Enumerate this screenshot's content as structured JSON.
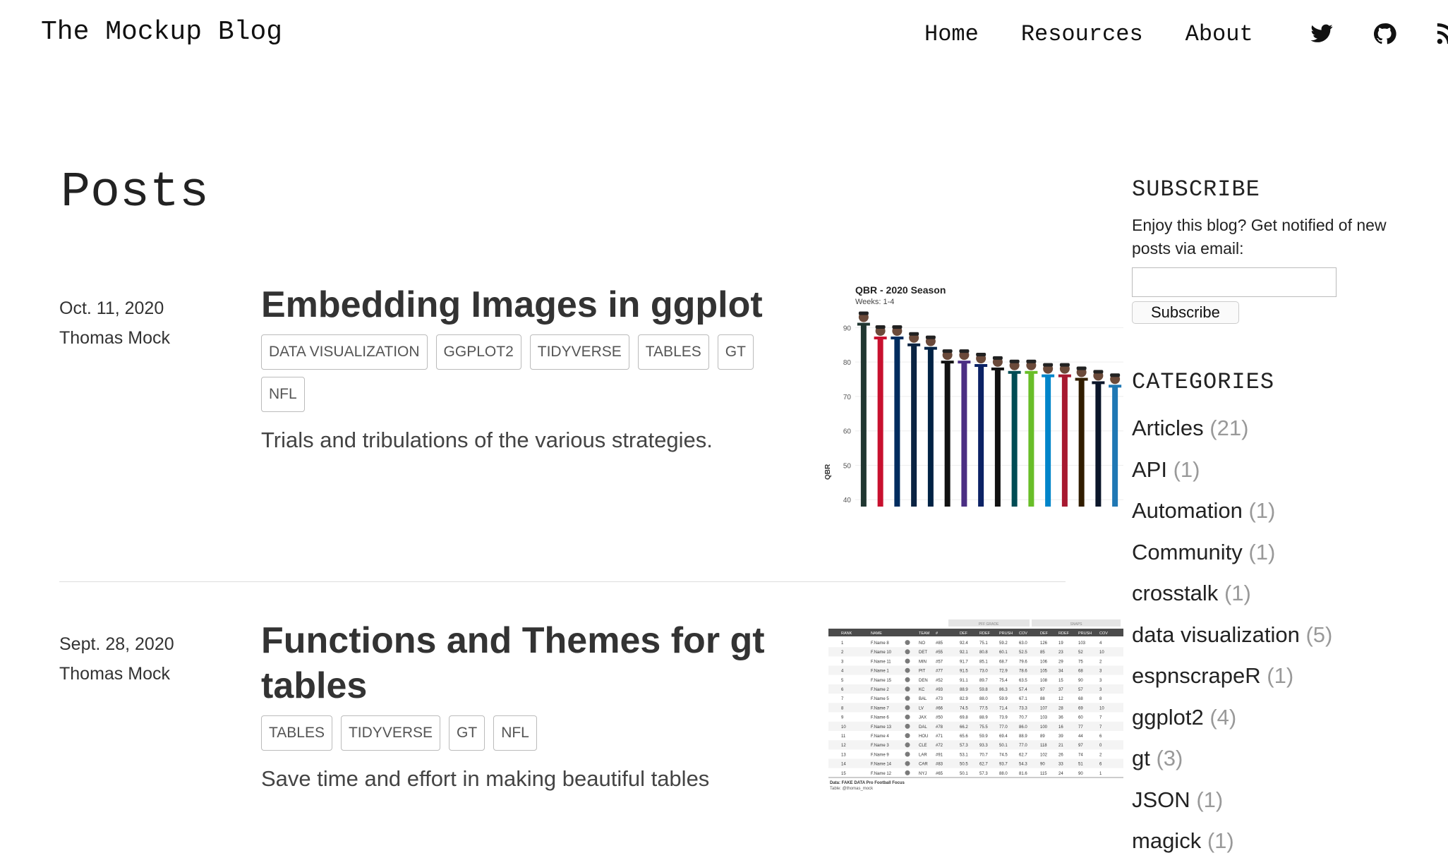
{
  "site": {
    "title": "The Mockup Blog"
  },
  "nav": {
    "links": [
      "Home",
      "Resources",
      "About"
    ],
    "icons": [
      "twitter-icon",
      "github-icon",
      "rss-icon"
    ]
  },
  "page": {
    "heading": "Posts"
  },
  "posts": [
    {
      "date": "Oct. 11, 2020",
      "author": "Thomas Mock",
      "title": "Embedding Images in ggplot",
      "tags": [
        "DATA VISUALIZATION",
        "GGPLOT2",
        "TIDYVERSE",
        "TABLES",
        "GT",
        "NFL"
      ],
      "description": "Trials and tribulations of the various strategies."
    },
    {
      "date": "Sept. 28, 2020",
      "author": "Thomas Mock",
      "title": "Functions and Themes for gt tables",
      "tags": [
        "TABLES",
        "TIDYVERSE",
        "GT",
        "NFL"
      ],
      "description": "Save time and effort in making beautiful tables"
    }
  ],
  "thumb1": {
    "title": "QBR - 2020 Season",
    "subtitle": "Weeks: 1-4",
    "ylabel": "QBR",
    "yticks": [
      "90",
      "80",
      "70",
      "60",
      "50",
      "40"
    ],
    "chart_data": {
      "type": "bar",
      "title": "QBR - 2020 Season",
      "subtitle": "Weeks: 1-4",
      "xlabel": "",
      "ylabel": "QBR",
      "ylim": [
        38,
        95
      ],
      "values": [
        91,
        87,
        87,
        85,
        84,
        80,
        80,
        79,
        78,
        77,
        77,
        76,
        76,
        75,
        74,
        73
      ],
      "colors": [
        "#203731",
        "#c8102e",
        "#002c5f",
        "#0a2342",
        "#002244",
        "#111111",
        "#4b2e83",
        "#0b2265",
        "#111111",
        "#004c54",
        "#69be28",
        "#0085ca",
        "#a71930",
        "#311d00",
        "#0b162a",
        "#1f78b4"
      ]
    }
  },
  "thumb2": {
    "group_headers": [
      "PFF GRADE",
      "SNAPS"
    ],
    "columns": [
      "RANK",
      "NAME",
      "TEAM",
      "#",
      "DEF",
      "RDEF",
      "PRUSH",
      "COV",
      "DEF",
      "RDEF",
      "PRUSH",
      "COV"
    ],
    "rows": [
      [
        "1",
        "F.Name 8",
        "NO",
        "#85",
        "92.4",
        "75.1",
        "59.2",
        "63.0",
        "126",
        "19",
        "103",
        "4"
      ],
      [
        "2",
        "F.Name 10",
        "DET",
        "#55",
        "92.1",
        "80.8",
        "60.1",
        "52.5",
        "85",
        "23",
        "52",
        "10"
      ],
      [
        "3",
        "F.Name 11",
        "MIN",
        "#57",
        "91.7",
        "85.1",
        "68.7",
        "79.6",
        "106",
        "29",
        "75",
        "2"
      ],
      [
        "4",
        "F.Name 1",
        "PIT",
        "#77",
        "91.5",
        "73.0",
        "72.9",
        "78.6",
        "105",
        "34",
        "68",
        "3"
      ],
      [
        "5",
        "F.Name 15",
        "DEN",
        "#52",
        "91.1",
        "89.7",
        "75.4",
        "63.5",
        "108",
        "15",
        "90",
        "3"
      ],
      [
        "6",
        "F.Name 2",
        "KC",
        "#93",
        "88.9",
        "59.8",
        "86.3",
        "57.4",
        "97",
        "37",
        "57",
        "3"
      ],
      [
        "7",
        "F.Name 5",
        "BAL",
        "#73",
        "82.9",
        "88.0",
        "59.9",
        "67.1",
        "88",
        "12",
        "68",
        "8"
      ],
      [
        "8",
        "F.Name 7",
        "LV",
        "#66",
        "74.5",
        "77.5",
        "71.4",
        "73.3",
        "107",
        "28",
        "69",
        "10"
      ],
      [
        "9",
        "F.Name 6",
        "JAX",
        "#50",
        "69.8",
        "88.9",
        "73.9",
        "70.7",
        "103",
        "36",
        "60",
        "7"
      ],
      [
        "10",
        "F.Name 13",
        "DAL",
        "#78",
        "66.2",
        "75.5",
        "77.0",
        "86.0",
        "100",
        "16",
        "77",
        "7"
      ],
      [
        "11",
        "F.Name 4",
        "HOU",
        "#71",
        "65.6",
        "59.9",
        "69.4",
        "88.9",
        "89",
        "39",
        "44",
        "6"
      ],
      [
        "12",
        "F.Name 3",
        "CLE",
        "#72",
        "57.3",
        "93.3",
        "50.1",
        "77.0",
        "118",
        "21",
        "97",
        "0"
      ],
      [
        "13",
        "F.Name 9",
        "LAR",
        "#91",
        "53.1",
        "70.7",
        "74.5",
        "62.7",
        "102",
        "26",
        "74",
        "2"
      ],
      [
        "14",
        "F.Name 14",
        "CAR",
        "#83",
        "50.5",
        "62.7",
        "93.7",
        "54.3",
        "90",
        "33",
        "51",
        "6"
      ],
      [
        "15",
        "F.Name 12",
        "NYJ",
        "#65",
        "50.1",
        "57.3",
        "88.0",
        "81.6",
        "115",
        "24",
        "90",
        "1"
      ]
    ],
    "footnote_1": "Data: FAKE DATA Pro Football Focus",
    "footnote_2": "Table: @thomas_mock"
  },
  "sidebar": {
    "subscribe_heading": "SUBSCRIBE",
    "subscribe_text": "Enjoy this blog? Get notified of new posts via email:",
    "email_placeholder": "",
    "subscribe_button": "Subscribe",
    "categories_heading": "CATEGORIES",
    "categories": [
      {
        "name": "Articles",
        "count": "(21)"
      },
      {
        "name": "API",
        "count": "(1)"
      },
      {
        "name": "Automation",
        "count": "(1)"
      },
      {
        "name": "Community",
        "count": "(1)"
      },
      {
        "name": "crosstalk",
        "count": "(1)"
      },
      {
        "name": "data visualization",
        "count": "(5)"
      },
      {
        "name": "espnscrapeR",
        "count": "(1)"
      },
      {
        "name": "ggplot2",
        "count": "(4)"
      },
      {
        "name": "gt",
        "count": "(3)"
      },
      {
        "name": "JSON",
        "count": "(1)"
      },
      {
        "name": "magick",
        "count": "(1)"
      }
    ]
  }
}
